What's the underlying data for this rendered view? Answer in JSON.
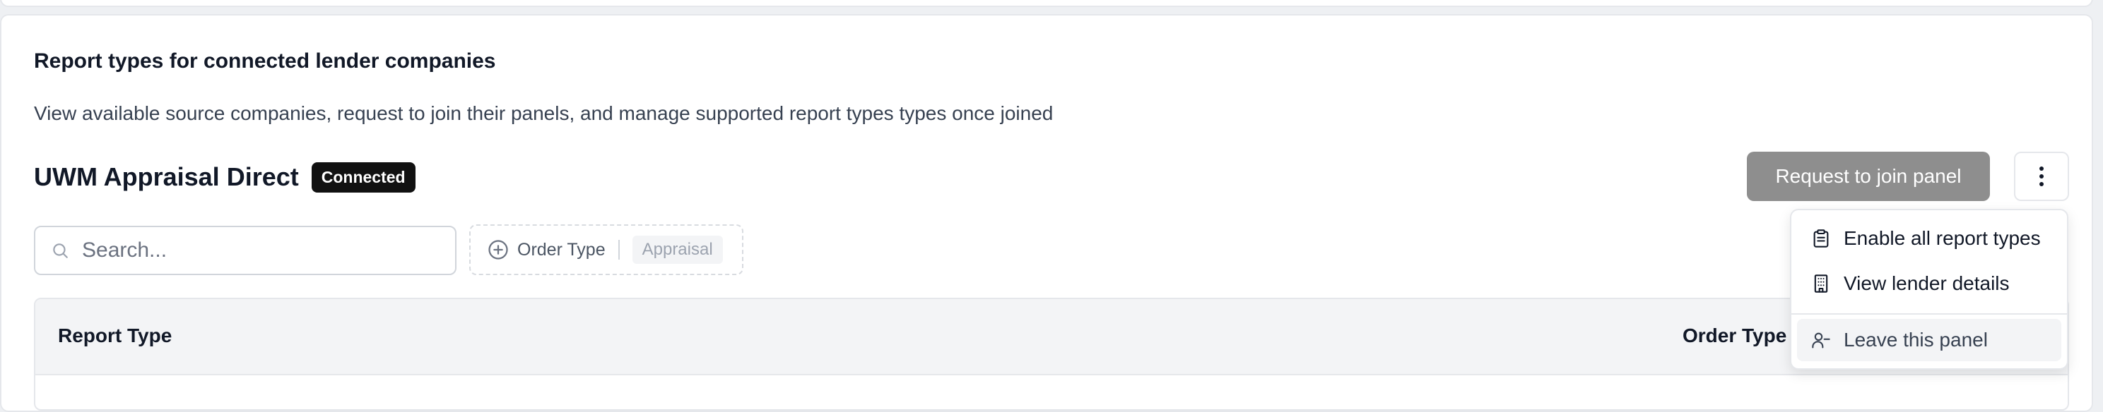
{
  "section": {
    "title": "Report types for connected lender companies",
    "description": "View available source companies, request to join their panels, and manage supported report types types once joined"
  },
  "company": {
    "name": "UWM Appraisal Direct",
    "status_badge": "Connected"
  },
  "actions": {
    "request_label": "Request to join panel",
    "more_icon": "more-vertical-icon"
  },
  "search": {
    "placeholder": "Search...",
    "value": ""
  },
  "filter": {
    "label": "Order Type",
    "selected": "Appraisal"
  },
  "table": {
    "columns": [
      "Report Type",
      "Order Type"
    ]
  },
  "menu": {
    "items": [
      {
        "label": "Enable all report types",
        "icon": "clipboard-icon"
      },
      {
        "label": "View lender details",
        "icon": "building-icon"
      },
      {
        "label": "Leave this panel",
        "icon": "user-minus-icon"
      }
    ]
  }
}
